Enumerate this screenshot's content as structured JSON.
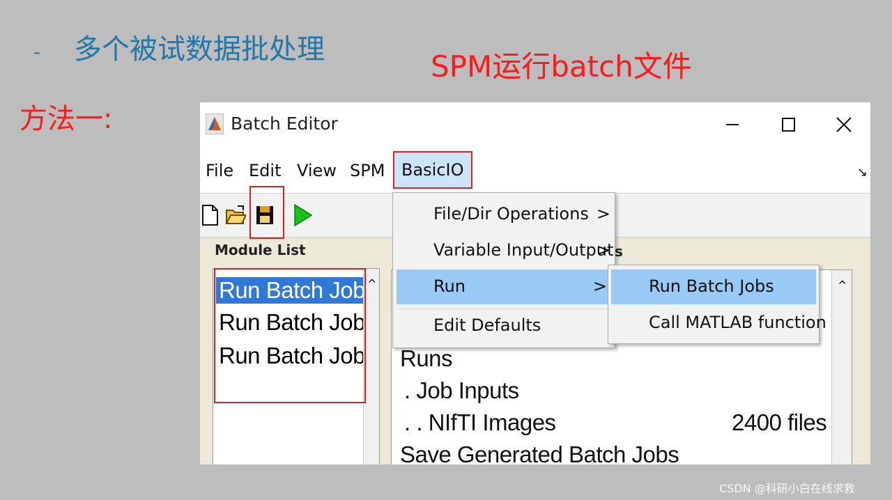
{
  "slide": {
    "bullet": "-",
    "title": "多个被试数据批处理",
    "caption": "SPM运行batch文件",
    "method": "方法一:",
    "watermark": "CSDN @科研小白在线求救"
  },
  "window": {
    "title": "Batch Editor",
    "controls": [
      "—",
      "☐",
      "✕"
    ]
  },
  "menubar": {
    "items": [
      "File",
      "Edit",
      "View",
      "SPM",
      "BasicIO"
    ],
    "corner": "↘"
  },
  "toolbar": {
    "icons": [
      "new-file-icon",
      "open-folder-icon",
      "save-icon",
      "run-icon"
    ]
  },
  "module_list": {
    "label": "Module List",
    "items": [
      "Run Batch Jobs",
      "Run Batch Jobs",
      "Run Batch Jobs"
    ],
    "selected_index": 0,
    "scroll_up": "^"
  },
  "detail": {
    "header_tail": "s",
    "lines": [
      "Runs",
      ". Job Inputs",
      ". . NIfTI Images",
      "Save Generated Batch Jobs"
    ],
    "file_count": "2400 files",
    "scroll_up": "^"
  },
  "basicio_menu": {
    "items": [
      {
        "label": "File/Dir Operations",
        "arrow": ">"
      },
      {
        "label": "Variable Input/Output",
        "arrow": ">"
      },
      {
        "label": "Run",
        "arrow": ">"
      },
      {
        "label": "Edit Defaults",
        "arrow": ""
      }
    ],
    "highlighted_index": 2
  },
  "run_submenu": {
    "items": [
      "Run Batch Jobs",
      "Call MATLAB function"
    ],
    "highlighted_index": 0
  },
  "colors": {
    "annotation_red": "#e02020",
    "title_blue": "#2078a8",
    "selection_blue": "#3079d6",
    "menu_highlight": "#99c9f5",
    "background_gray": "#bdbdbd"
  }
}
